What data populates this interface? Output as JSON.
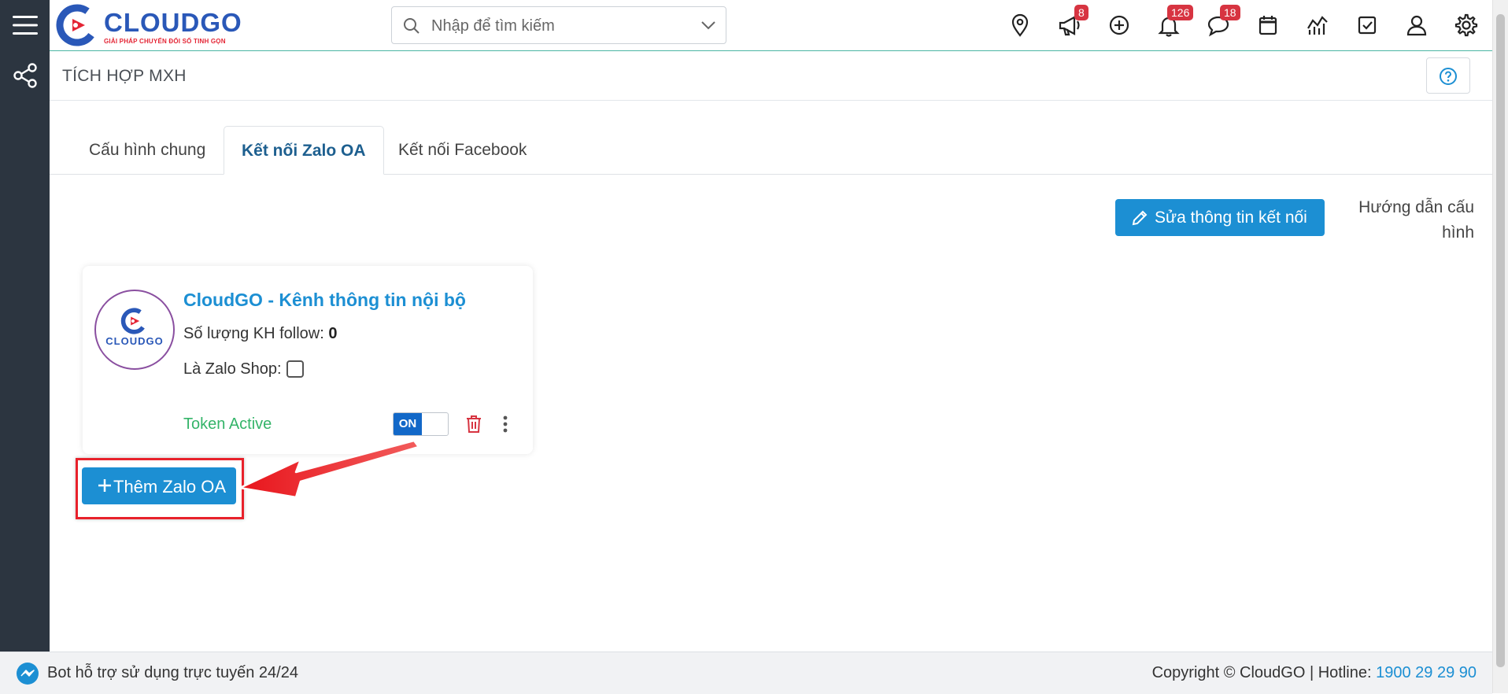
{
  "brand": {
    "name": "CLOUDGO",
    "tagline": "GIẢI PHÁP CHUYỂN ĐỔI SỐ TINH GỌN",
    "primary_color": "#1c8fd3",
    "logo_blue": "#2a58b8",
    "logo_red": "#e42535",
    "sidebar_color": "#2c3540"
  },
  "search": {
    "placeholder": "Nhập để tìm kiếm"
  },
  "header_icons": [
    {
      "name": "location-pin-icon"
    },
    {
      "name": "megaphone-icon",
      "badge": "8"
    },
    {
      "name": "plus-circle-icon"
    },
    {
      "name": "bell-icon",
      "badge": "126"
    },
    {
      "name": "chat-bubble-icon",
      "badge": "18"
    },
    {
      "name": "calendar-icon"
    },
    {
      "name": "line-chart-icon"
    },
    {
      "name": "checkbox-icon"
    },
    {
      "name": "user-icon"
    },
    {
      "name": "gear-icon"
    }
  ],
  "page": {
    "title": "TÍCH HỢP MXH"
  },
  "tabs": [
    {
      "label": "Cấu hình chung",
      "active": false
    },
    {
      "label": "Kết nối Zalo OA",
      "active": true
    },
    {
      "label": "Kết nối Facebook",
      "active": false
    }
  ],
  "actions": {
    "edit_label": "Sửa thông tin kết nối",
    "guide_label": "Hướng dẫn cấu hình"
  },
  "oa_card": {
    "avatar_word": "CLOUDGO",
    "title": "CloudGO - Kênh thông tin nội bộ",
    "follow_label": "Số lượng KH follow:",
    "follow_count": "0",
    "zalo_shop_label": "Là Zalo Shop:",
    "zalo_shop_checked": false,
    "token_status": "Token Active",
    "toggle_label": "ON",
    "toggle_on": true
  },
  "add_button": {
    "label": "Thêm Zalo OA"
  },
  "footer": {
    "bot_text": "Bot hỗ trợ sử dụng trực tuyến 24/24",
    "copyright": "Copyright © CloudGO | Hotline: ",
    "hotline": "1900 29 29 90"
  }
}
